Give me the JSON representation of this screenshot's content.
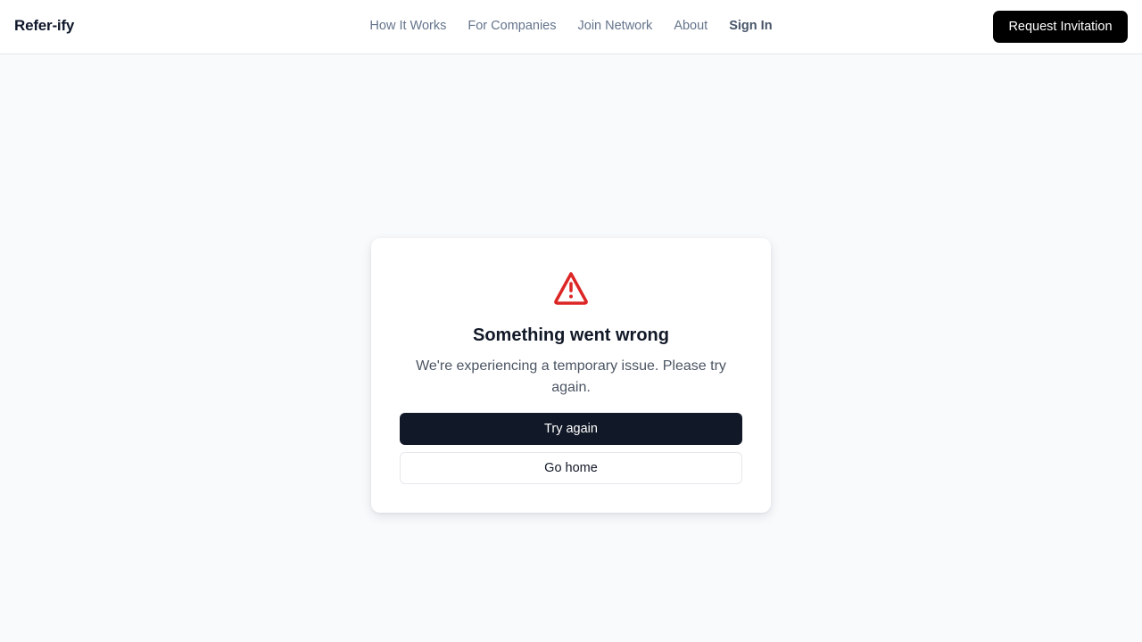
{
  "header": {
    "brand": "Refer-ify",
    "nav": {
      "how_it_works": "How It Works",
      "for_companies": "For Companies",
      "join_network": "Join Network",
      "about": "About",
      "sign_in": "Sign In"
    },
    "cta_label": "Request Invitation"
  },
  "error_card": {
    "icon": "warning-triangle-icon",
    "icon_color": "#dc2626",
    "title": "Something went wrong",
    "message": "We're experiencing a temporary issue. Please try again.",
    "primary_label": "Try again",
    "secondary_label": "Go home"
  }
}
